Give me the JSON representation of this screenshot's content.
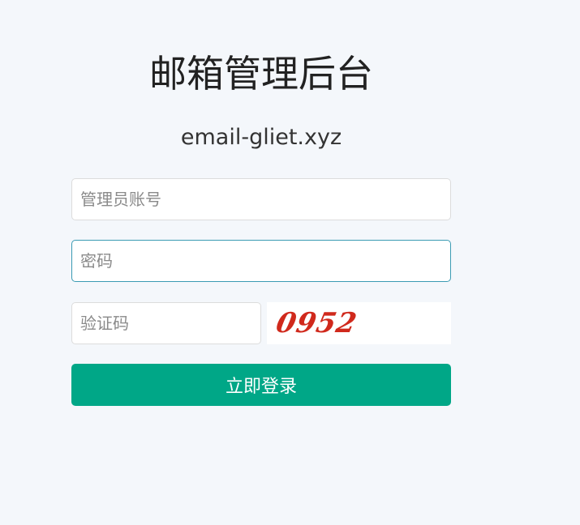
{
  "header": {
    "title": "邮箱管理后台",
    "subtitle": "email-gliet.xyz"
  },
  "form": {
    "account_placeholder": "管理员账号",
    "password_placeholder": "密码",
    "captcha_placeholder": "验证码",
    "captcha_image_text": "0952",
    "submit_label": "立即登录"
  },
  "colors": {
    "background": "#f4f7fb",
    "primary_button": "#00a787",
    "focused_border": "#3b9bb3",
    "captcha_text": "#d0291c"
  }
}
